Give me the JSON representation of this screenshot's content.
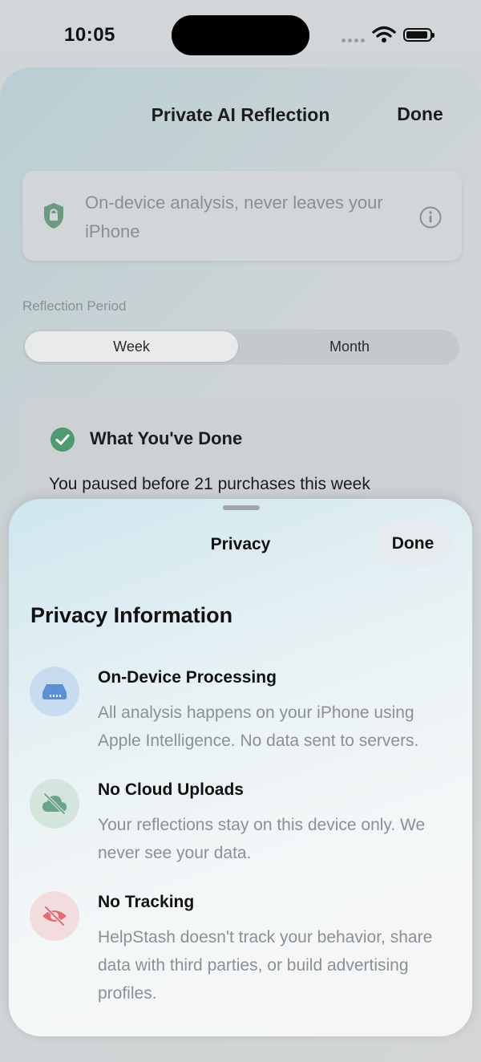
{
  "status_bar": {
    "time": "10:05"
  },
  "background_screen": {
    "title": "Private AI Reflection",
    "done_label": "Done",
    "info_card_text": "On-device analysis, never leaves your iPhone",
    "period_label": "Reflection Period",
    "segments": [
      {
        "label": "Week",
        "selected": true
      },
      {
        "label": "Month",
        "selected": false
      }
    ],
    "summary_card": {
      "title": "What You've Done",
      "line": "You paused before 21 purchases this week"
    }
  },
  "privacy_sheet": {
    "title": "Privacy",
    "done_label": "Done",
    "heading": "Privacy Information",
    "items": [
      {
        "icon": "drive-icon",
        "title": "On-Device Processing",
        "description": "All analysis happens on your iPhone using Apple Intelligence. No data sent to servers."
      },
      {
        "icon": "cloud-slash-icon",
        "title": "No Cloud Uploads",
        "description": "Your reflections stay on this device only. We never see your data."
      },
      {
        "icon": "eye-slash-icon",
        "title": "No Tracking",
        "description": "HelpStash doesn't track your behavior, share data with third parties, or build advertising profiles."
      }
    ]
  },
  "colors": {
    "accent_blue": "#5b8fd6",
    "accent_green": "#6aa38a",
    "accent_red": "#e36b72",
    "check_green": "#4f9a70"
  }
}
